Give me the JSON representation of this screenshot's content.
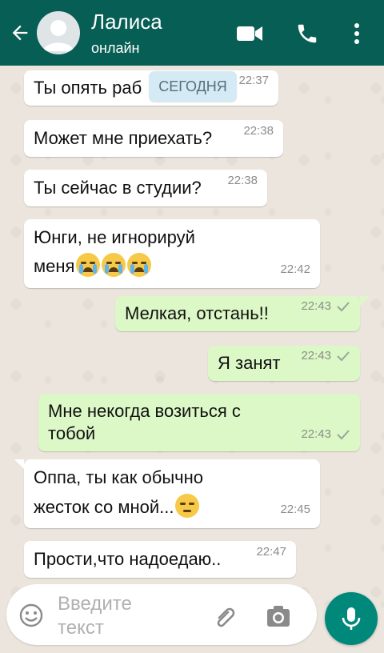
{
  "header": {
    "contact_name": "Лалиса",
    "status": "онлайн",
    "back_icon": "back-arrow-icon",
    "video_icon": "video-call-icon",
    "call_icon": "phone-icon",
    "menu_icon": "more-vert-icon",
    "color": "#075e54"
  },
  "date_chip": "СЕГОДНЯ",
  "messages": [
    {
      "direction": "in",
      "text": "Ты опять раб",
      "time": "22:37"
    },
    {
      "direction": "in",
      "text": "Может мне приехать?",
      "time": "22:38"
    },
    {
      "direction": "in",
      "text": "Ты сейчас в студии?",
      "time": "22:38"
    },
    {
      "direction": "in",
      "line1": "Юнги, не игнорируй",
      "line2": "меня",
      "emoji": "loudly-crying-face x3",
      "time": "22:42"
    },
    {
      "direction": "out",
      "text": "Мелкая, отстань!!",
      "time": "22:43",
      "read": true
    },
    {
      "direction": "out",
      "text": "Я занят",
      "time": "22:43",
      "read": true
    },
    {
      "direction": "out",
      "line1": "Мне некогда возиться с",
      "line2": "тобой",
      "time": "22:43",
      "read": true
    },
    {
      "direction": "in",
      "line1": "Оппа, ты как обычно",
      "line2": "жесток со мной...",
      "emoji": "pensive-face",
      "time": "22:45"
    },
    {
      "direction": "in",
      "text": "Прости,что надоедаю..",
      "time": "22:47"
    }
  ],
  "composer": {
    "placeholder_line1": "Введите",
    "placeholder_line2": "текст",
    "emoji_icon": "emoji-icon",
    "attach_icon": "paperclip-icon",
    "camera_icon": "camera-icon",
    "mic_icon": "microphone-icon"
  },
  "colors": {
    "incoming_bubble": "#ffffff",
    "outgoing_bubble": "#dcf8c6",
    "accent": "#00897b",
    "tick": "#9aa59b"
  }
}
